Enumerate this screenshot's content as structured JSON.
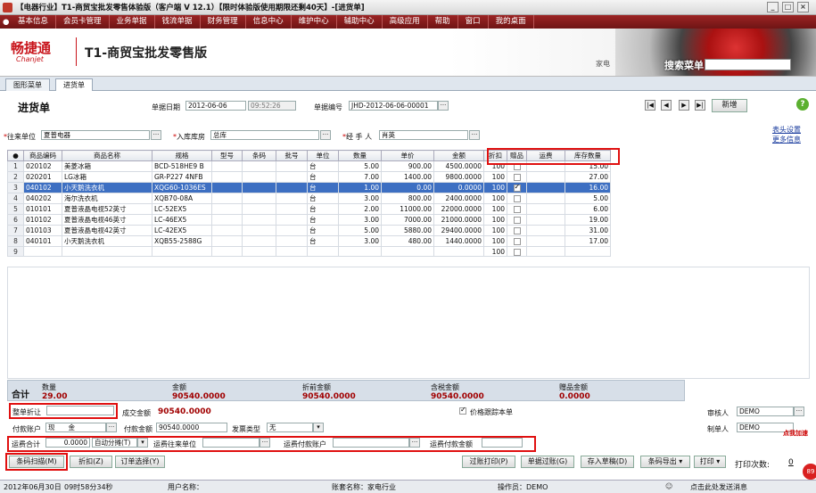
{
  "window": {
    "title": "【电器行业】T1-商贸宝批发零售体验版（客户端 V 12.1）【限时体验版使用期限还剩40天】-[进货单]"
  },
  "menu": [
    "基本信息",
    "会员卡管理",
    "业务单据",
    "钱流单据",
    "财务管理",
    "信息中心",
    "维护中心",
    "辅助中心",
    "高级应用",
    "帮助",
    "窗口",
    "我的桌面"
  ],
  "banner": {
    "logo": "畅捷通",
    "logo_sub": "Chanjet",
    "app_name": "T1-商贸宝批发零售版",
    "home": "家电",
    "search_label": "搜索菜单"
  },
  "tabs": [
    "图形菜单",
    "进货单"
  ],
  "form": {
    "title": "进货单",
    "date_label": "单据日期",
    "date": "2012-06-06",
    "time": "09:52:26",
    "no_label": "单据编号",
    "no": "JHD-2012-06-06-00001",
    "new_label": "新增",
    "supplier_label": "往来单位",
    "supplier": "夏普电器",
    "warehouse_label": "入库库房",
    "warehouse": "总库",
    "handler_label": "经 手 人",
    "handler": "肖英",
    "header_settings": "表头设置",
    "more_info": "更多信息"
  },
  "grid": {
    "columns": [
      "商品编码",
      "商品名称",
      "规格",
      "型号",
      "条码",
      "批号",
      "单位",
      "数量",
      "单价",
      "金额",
      "折扣",
      "赠品",
      "运费",
      "库存数量"
    ],
    "rows": [
      {
        "n": "1",
        "code": "020102",
        "name": "美菱冰箱",
        "spec": "BCD-518HE9 B",
        "unit": "台",
        "qty": "5.00",
        "price": "900.00",
        "amount": "4500.0000",
        "disc": "100",
        "gift": false,
        "stock": "15.00"
      },
      {
        "n": "2",
        "code": "020201",
        "name": "LG冰箱",
        "spec": "GR-P227 4NFB",
        "unit": "台",
        "qty": "7.00",
        "price": "1400.00",
        "amount": "9800.0000",
        "disc": "100",
        "gift": false,
        "stock": "27.00"
      },
      {
        "n": "3",
        "code": "040102",
        "name": "小天鹅洗衣机",
        "spec": "XQG60-1036ES",
        "unit": "台",
        "qty": "1.00",
        "price": "0.00",
        "amount": "0.0000",
        "disc": "100",
        "gift": true,
        "stock": "16.00"
      },
      {
        "n": "4",
        "code": "040202",
        "name": "海尔洗衣机",
        "spec": "XQB70-08A",
        "unit": "台",
        "qty": "3.00",
        "price": "800.00",
        "amount": "2400.0000",
        "disc": "100",
        "gift": false,
        "stock": "5.00"
      },
      {
        "n": "5",
        "code": "010101",
        "name": "夏普液晶电视52英寸",
        "spec": "LC-52EX5",
        "unit": "台",
        "qty": "2.00",
        "price": "11000.00",
        "amount": "22000.0000",
        "disc": "100",
        "gift": false,
        "stock": "6.00"
      },
      {
        "n": "6",
        "code": "010102",
        "name": "夏普液晶电视46英寸",
        "spec": "LC-46EX5",
        "unit": "台",
        "qty": "3.00",
        "price": "7000.00",
        "amount": "21000.0000",
        "disc": "100",
        "gift": false,
        "stock": "19.00"
      },
      {
        "n": "7",
        "code": "010103",
        "name": "夏普液晶电视42英寸",
        "spec": "LC-42EX5",
        "unit": "台",
        "qty": "5.00",
        "price": "5880.00",
        "amount": "29400.0000",
        "disc": "100",
        "gift": false,
        "stock": "31.00"
      },
      {
        "n": "8",
        "code": "040101",
        "name": "小天鹅洗衣机",
        "spec": "XQB55-2588G",
        "unit": "台",
        "qty": "3.00",
        "price": "480.00",
        "amount": "1440.0000",
        "disc": "100",
        "gift": false,
        "stock": "17.00"
      },
      {
        "n": "9",
        "code": "",
        "name": "",
        "spec": "",
        "unit": "",
        "qty": "",
        "price": "",
        "amount": "",
        "disc": "100",
        "gift": false,
        "stock": ""
      }
    ]
  },
  "totals": {
    "label": "合计",
    "qty_label": "数量",
    "qty": "29.00",
    "amount_label": "金额",
    "amount": "90540.0000",
    "pre_disc_label": "折前金额",
    "pre_disc": "90540.0000",
    "tax_label": "含税金额",
    "tax": "90540.0000",
    "gift_label": "赠品金额",
    "gift": "0.0000"
  },
  "footer": {
    "whole_disc_label": "整单折让",
    "whole_disc": "",
    "deal_label": "成交金额",
    "deal": "90540.0000",
    "track_cost": "价格跟踪本单",
    "auditor_label": "审核人",
    "auditor": "DEMO",
    "maker_label": "制单人",
    "maker": "DEMO",
    "pay_account_label": "付款账户",
    "pay_account": "现　　金",
    "pay_amount_label": "付款金额",
    "pay_amount": "90540.0000",
    "invoice_label": "发票类型",
    "invoice": "无",
    "freight_total_label": "运费合计",
    "freight_total": "0.0000",
    "freight_method": "自动分摊(T)",
    "freight_unit_label": "运费往来单位",
    "freight_account_label": "运费付款账户",
    "freight_pay_label": "运费付款金额"
  },
  "buttons": {
    "barcode": "条码扫描(M)",
    "discount": "折扣(Z)",
    "order": "订单选择(Y)",
    "post_print": "过账打印(P)",
    "post": "单据过账(G)",
    "draft": "存入草稿(D)",
    "barcode_export": "条码导出",
    "print": "打印",
    "print_count_label": "打印次数:",
    "print_count": "0"
  },
  "status": {
    "date": "2012年06月30日",
    "time": "09时58分34秒",
    "user_label": "用户名称：",
    "account": "账套名称：家电行业",
    "operator": "操作员：DEMO",
    "msg": "点击此处发送消息"
  },
  "side": {
    "tag": "点我加速",
    "badge": "89"
  }
}
